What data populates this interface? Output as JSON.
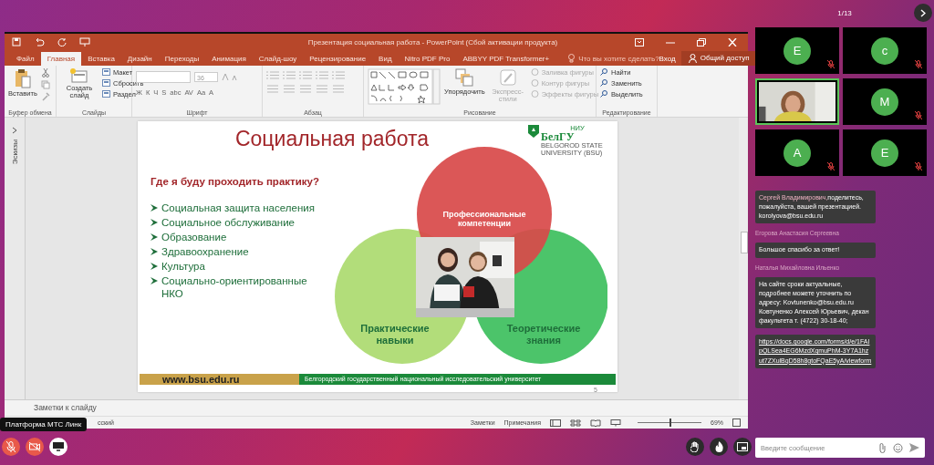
{
  "meeting": {
    "page_counter": "1/13",
    "tooltip": "Платформа МТС Линк"
  },
  "powerpoint": {
    "title": "Презентация социальная работа - PowerPoint (Сбой активации продукта)",
    "tabs": [
      {
        "label": "Файл",
        "selected": false
      },
      {
        "label": "Главная",
        "selected": true
      },
      {
        "label": "Вставка",
        "selected": false
      },
      {
        "label": "Дизайн",
        "selected": false
      },
      {
        "label": "Переходы",
        "selected": false
      },
      {
        "label": "Анимация",
        "selected": false
      },
      {
        "label": "Слайд-шоу",
        "selected": false
      },
      {
        "label": "Рецензирование",
        "selected": false
      },
      {
        "label": "Вид",
        "selected": false
      },
      {
        "label": "Nitro PDF Pro",
        "selected": false
      },
      {
        "label": "ABBYY PDF Transformer+",
        "selected": false
      }
    ],
    "tell_me": "Что вы хотите сделать?",
    "sign_in": "Вход",
    "share": "Общий доступ",
    "ribbon": {
      "clipboard": {
        "label": "Буфер обмена",
        "paste": "Вставить"
      },
      "slides": {
        "label": "Слайды",
        "create": "Создать слайд",
        "small": [
          "Макет",
          "Сбросить",
          "Раздел"
        ]
      },
      "font": {
        "label": "Шрифт",
        "size": "36",
        "format": [
          "Ж",
          "К",
          "Ч",
          "S",
          "abc",
          "AV",
          "Aa",
          "A"
        ]
      },
      "paragraph": {
        "label": "Абзац"
      },
      "drawing": {
        "label": "Рисование",
        "arrange": "Упорядочить",
        "quick_styles": {
          "label": "Экспресс-стили",
          "disabled": true
        },
        "shape_options": [
          {
            "label": "Заливка фигуры",
            "disabled": true
          },
          {
            "label": "Контур фигуры",
            "disabled": true
          },
          {
            "label": "Эффекты фигуры",
            "disabled": true
          }
        ]
      },
      "editing": {
        "label": "Редактирование",
        "buttons": [
          "Найти",
          "Заменить",
          "Выделить"
        ]
      }
    },
    "thumbnails_label": "Эскизы",
    "slide": {
      "title": "Социальная работа",
      "logo": {
        "top": "НИУ",
        "name": "БелГУ",
        "sub": "BELGOROD STATE UNIVERSITY (BSU)"
      },
      "question": "Где я буду проходить практику?",
      "bullets": [
        "Социальная защита населения",
        "Социальное обслуживание",
        "Образование",
        "Здравоохранение",
        "Культура",
        "Социально-ориентированные НКО"
      ],
      "circles": [
        {
          "label": "Профессиональные компетенции",
          "color": "#d84a4a"
        },
        {
          "label": "Практические навыки",
          "color": "#b2dd7a"
        },
        {
          "label": "Теоретические знания",
          "color": "#4cc46a"
        }
      ],
      "footer_url": "www.bsu.edu.ru",
      "footer_text": "Белгородский государственный национальный исследовательский университет",
      "number": "5"
    },
    "notes_placeholder": "Заметки к слайду",
    "status_bar": {
      "language": "сский",
      "notes": "Заметки",
      "comments": "Примечания",
      "zoom": "69%",
      "zoom_slider": {
        "level": 0.5
      }
    }
  },
  "participants": [
    {
      "kind": "avatar",
      "initial": "Е",
      "muted": true,
      "speaking": false
    },
    {
      "kind": "avatar",
      "initial": "с",
      "muted": true,
      "speaking": false
    },
    {
      "kind": "video",
      "muted": false,
      "speaking": true
    },
    {
      "kind": "avatar",
      "initial": "М",
      "muted": true,
      "speaking": false
    },
    {
      "kind": "avatar",
      "initial": "А",
      "muted": true,
      "speaking": false
    },
    {
      "kind": "avatar",
      "initial": "Е",
      "muted": true,
      "speaking": false
    }
  ],
  "chat": [
    {
      "kind": "message",
      "mention": "Сергей Владимирович,",
      "text": "поделитесь, пожалуйста, вашей презентацией. korolyova@bsu.edu.ru"
    },
    {
      "kind": "author",
      "text": "Егорова Анастасия Сергеевна"
    },
    {
      "kind": "message",
      "text": "Большое спасибо за ответ!"
    },
    {
      "kind": "author",
      "text": "Наталья Михайловна Ильенко"
    },
    {
      "kind": "message",
      "text": "На сайте сроки актуальные, подробнее можете уточнить по адресу: Kovtunenko@bsu.edu.ru Ковтуненко Алексей Юрьевич, декан факультета т. (4722) 30-18-40;"
    },
    {
      "kind": "link",
      "text": "https://docs.google.com/forms/d/e/1FAIpQLSea4EG6MzdXqmuPhM-3Y7A1hzut7ZXulBqD58h8gtoFQaE5yA/viewform"
    }
  ],
  "chat_input": {
    "placeholder": "Введите сообщение"
  },
  "controls": {
    "mic_muted": true,
    "camera_off": true
  }
}
